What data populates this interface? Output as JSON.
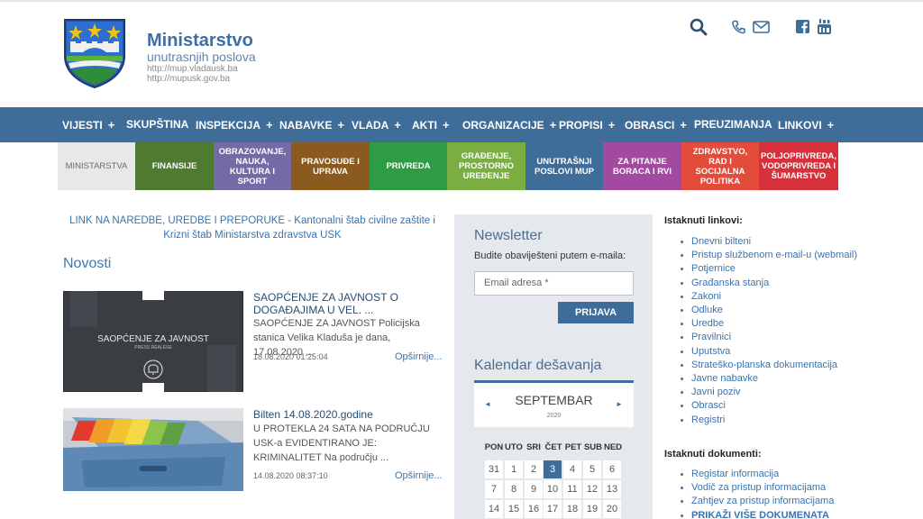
{
  "brand": {
    "title": "Ministarstvo",
    "subtitle": "unutrasnjih poslova",
    "url1": "http://mup.vladausk.ba",
    "url2": "http://mupusk.gov.ba"
  },
  "header_icons": [
    "search-icon",
    "phone-icon",
    "mail-icon",
    "facebook-icon",
    "youtube-icon"
  ],
  "nav": [
    {
      "label": "VIJESTI",
      "plus": "+"
    },
    {
      "label": "SKUPŠTINA",
      "plus": ""
    },
    {
      "label": "INSPEKCIJA",
      "plus": "+"
    },
    {
      "label": "NABAVKE",
      "plus": "+"
    },
    {
      "label": "VLADA",
      "plus": "+"
    },
    {
      "label": "AKTI",
      "plus": "+"
    },
    {
      "label": "ORGANIZACIJE",
      "plus": "+"
    },
    {
      "label": "PROPISI",
      "plus": "+"
    },
    {
      "label": "OBRASCI",
      "plus": "+"
    },
    {
      "label": "PREUZIMANJA",
      "plus": ""
    },
    {
      "label": "LINKOVI",
      "plus": "+"
    }
  ],
  "tiles": [
    {
      "label": "MINISTARSTVA",
      "color": "#e7e8ea"
    },
    {
      "label": "FINANSIJE",
      "color": "#4e7a32"
    },
    {
      "label": "OBRAZOVANJE, NAUKA, KULTURA I SPORT",
      "color": "#7569a6"
    },
    {
      "label": "PRAVOSUĐE I UPRAVA",
      "color": "#8b5a1f"
    },
    {
      "label": "PRIVREDA",
      "color": "#2e9c45"
    },
    {
      "label": "GRAĐENJE, PROSTORNO UREĐENJE",
      "color": "#7aae43"
    },
    {
      "label": "UNUTRAŠNJI POSLOVI MUP",
      "color": "#3f6d99"
    },
    {
      "label": "ZA PITANJE BORACA I RVI",
      "color": "#a14aa0"
    },
    {
      "label": "ZDRAVSTVO, RAD I SOCIJALNA POLITIKA",
      "color": "#e34b3b"
    },
    {
      "label": "POLJOPRIVREDA, VODOPRIVREDA I ŠUMARSTVO",
      "color": "#d6303a"
    }
  ],
  "link_notice": "LINK NA NAREDBE, UREDBE I PREPORUKE - Kantonalni štab civilne zaštite i Krizni štab Ministarstva zdravstva USK",
  "novosti": {
    "heading": "Novosti",
    "items": [
      {
        "image_text": "SAOPĆENJE ZA JAVNOST",
        "image_sub": "PRESS REALESE",
        "title": "SAOPĆENJE ZA JAVNOST O DOGAĐAJIMA U VEL. ...",
        "text": "SAOPĆENJE ZA JAVNOST Policijska stanica Velika Kladuša je dana, 17.08.2020 ...",
        "date": "18.08.2020 01:25:04",
        "more": "Opširnije..."
      },
      {
        "title": "Bilten 14.08.2020.godine",
        "text": "U PROTEKLA 24 SATA NA PODRUČJU USK-a EVIDENTIRANO JE: KRIMINALITET Na području ...",
        "date": "14.08.2020 08:37:10",
        "more": "Opširnije..."
      }
    ]
  },
  "newsletter": {
    "title": "Newsletter",
    "subtitle": "Budite obaviješteni putem e-maila:",
    "placeholder": "Email adresa *",
    "button": "PRIJAVA"
  },
  "calendar": {
    "title": "Kalendar dešavanja",
    "month": "SEPTEMBAR",
    "year": "2020",
    "prev": "◄",
    "next": "►",
    "day_names": [
      "PON",
      "UTO",
      "SRI",
      "ČET",
      "PET",
      "SUB",
      "NED"
    ],
    "rows": [
      [
        "31",
        "1",
        "2",
        "3",
        "4",
        "5",
        "6"
      ],
      [
        "7",
        "8",
        "9",
        "10",
        "11",
        "12",
        "13"
      ],
      [
        "14",
        "15",
        "16",
        "17",
        "18",
        "19",
        "20"
      ]
    ],
    "today": "3"
  },
  "istaknuti_linkovi": {
    "heading": "Istaknuti linkovi:",
    "items": [
      "Dnevni bilteni",
      "Pristup službenom e-mail-u (webmail)",
      "Potjernice",
      "Građanska stanja",
      "Zakoni",
      "Odluke",
      "Uredbe",
      "Pravilnici",
      "Uputstva",
      "Strateško-planska dokumentacija",
      "Javne nabavke",
      "Javni poziv",
      "Obrasci",
      "Registri"
    ]
  },
  "istaknuti_dokumenti": {
    "heading": "Istaknuti dokumenti:",
    "items": [
      "Registar informacija",
      "Vodič za pristup informacijama",
      "Zahtjev za pristup informacijama",
      "PRIKAŽI VIŠE DOKUMENATA"
    ]
  }
}
